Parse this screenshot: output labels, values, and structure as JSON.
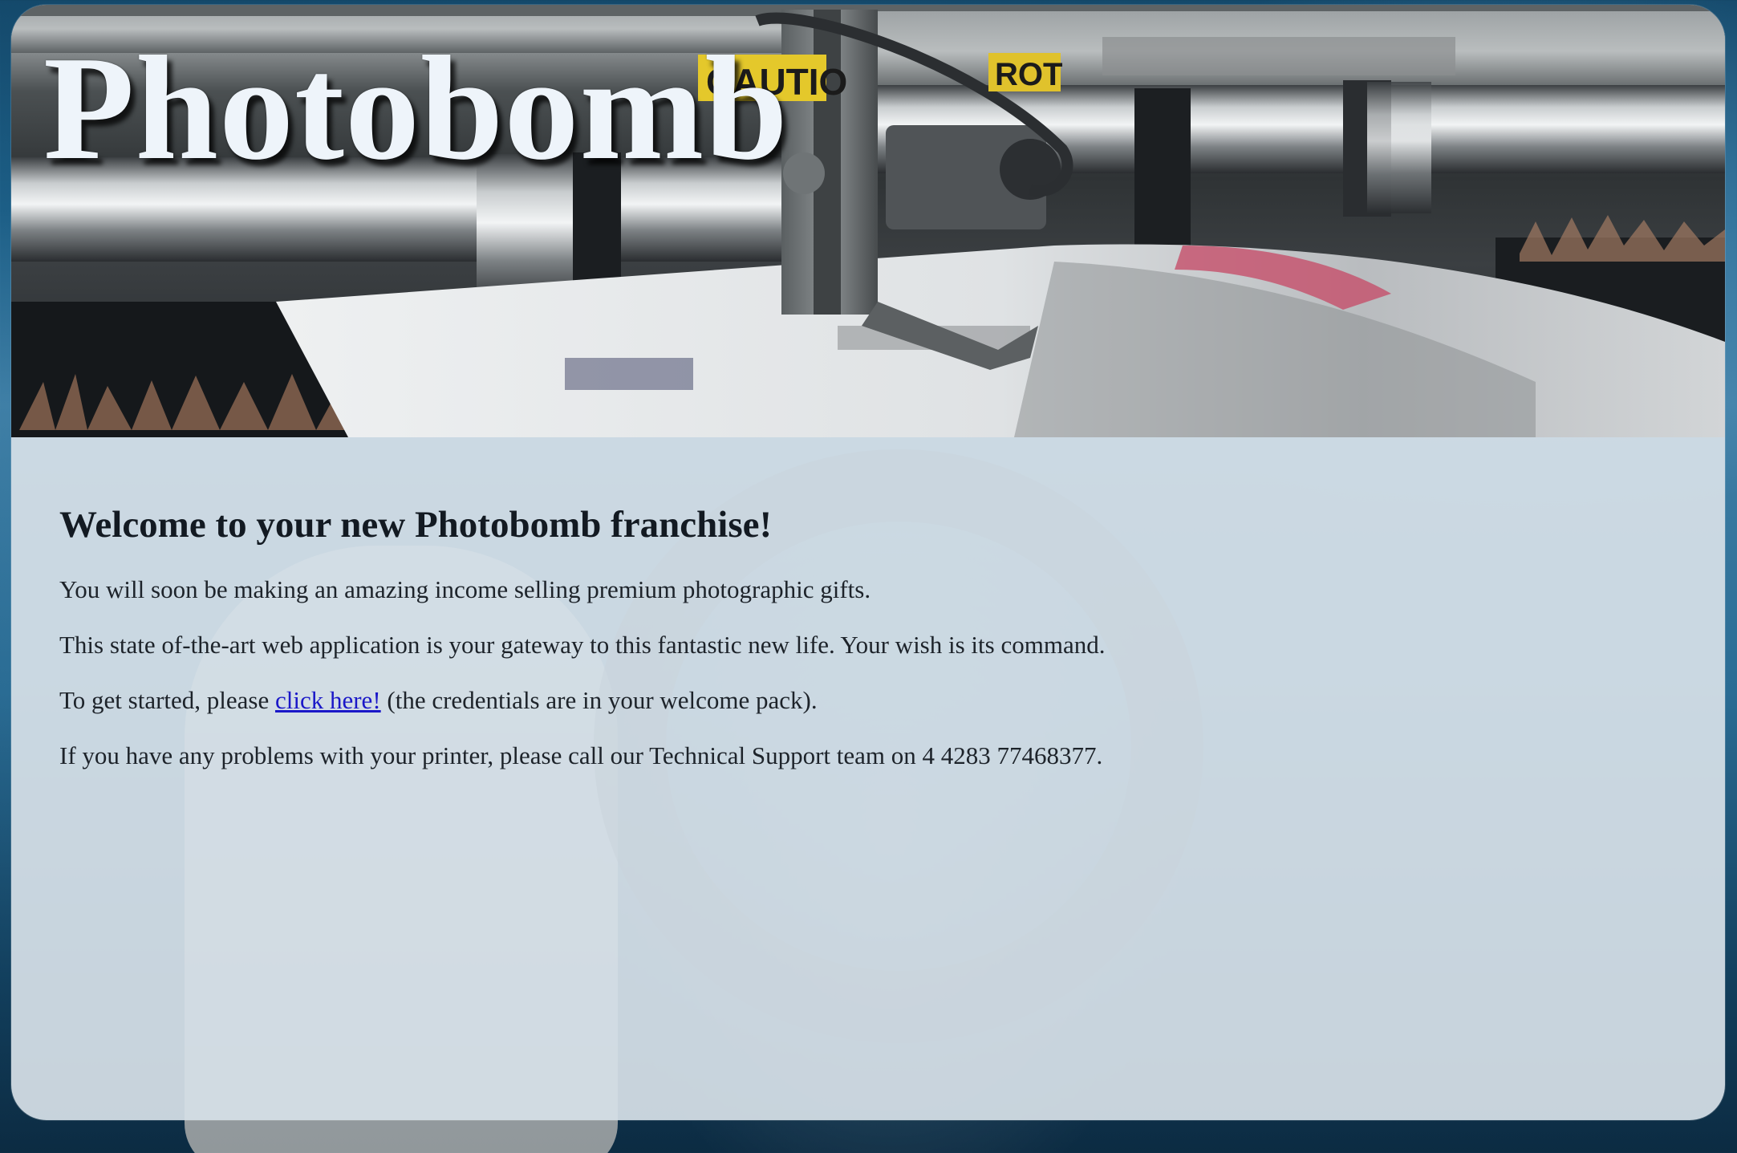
{
  "brand": {
    "title": "Photobomb"
  },
  "header_image": {
    "labels": [
      "CAUTIO",
      "ROT"
    ]
  },
  "main": {
    "heading": "Welcome to your new Photobomb franchise!",
    "paragraph1": "You will soon be making an amazing income selling premium photographic gifts.",
    "paragraph2": "This state of-the-art web application is your gateway to this fantastic new life. Your wish is its command.",
    "paragraph3_prefix": "To get started, please ",
    "login_link": "click here!",
    "paragraph3_suffix": " (the credentials are in your welcome pack).",
    "paragraph4": "If you have any problems with your printer, please call our Technical Support team on 4 4283 77468377."
  },
  "colors": {
    "link": "#1a17c8",
    "title_text": "#eef4fa",
    "panel": "#d6e0e7"
  }
}
